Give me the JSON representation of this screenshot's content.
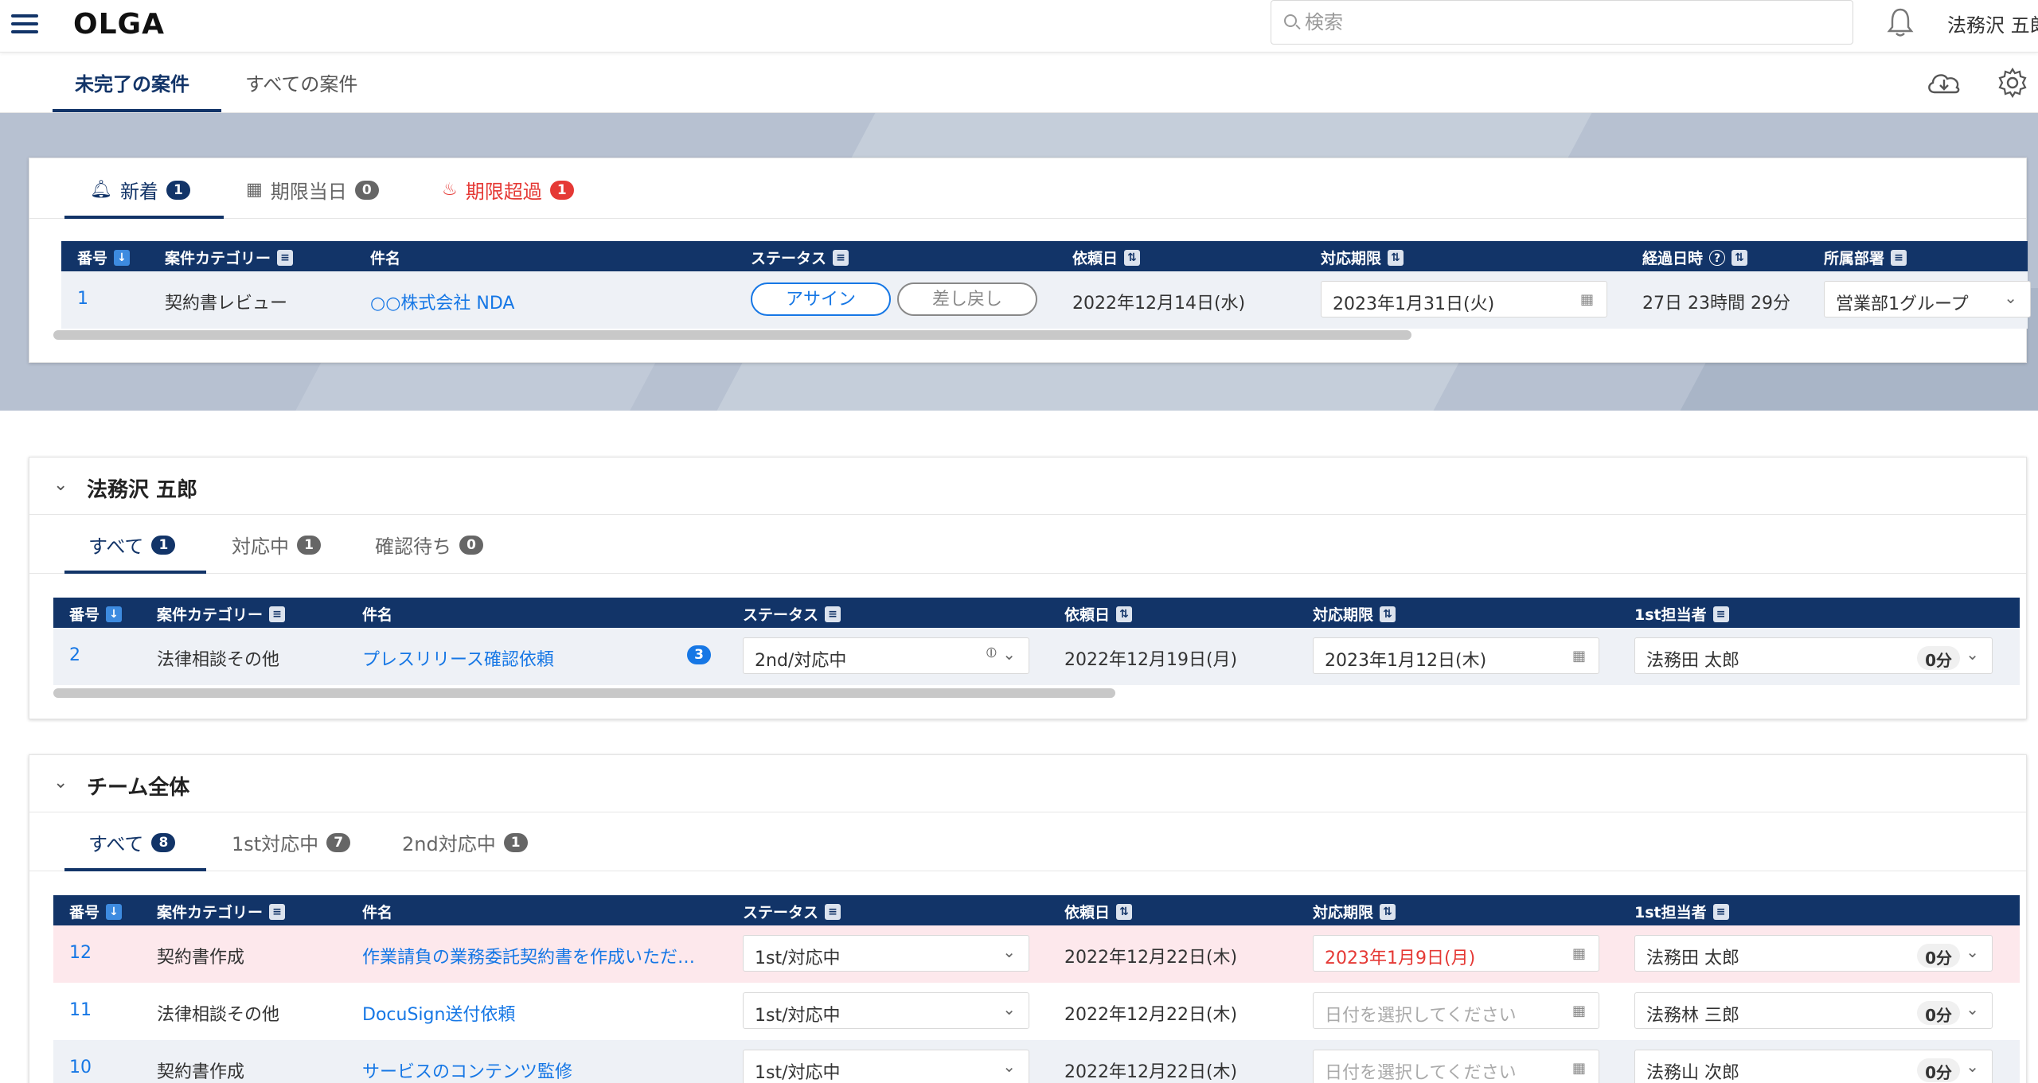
{
  "app": {
    "title": "OLGA"
  },
  "search": {
    "placeholder": "検索"
  },
  "user": {
    "name": "法務沢 五郎"
  },
  "main_tabs": [
    {
      "label": "未完了の案件",
      "active": true
    },
    {
      "label": "すべての案件",
      "active": false
    }
  ],
  "alerts": {
    "tabs": [
      {
        "label": "新着",
        "count": "1",
        "icon": "bell-icon"
      },
      {
        "label": "期限当日",
        "count": "0",
        "icon": "calendar-icon"
      },
      {
        "label": "期限超過",
        "count": "1",
        "icon": "fire-icon"
      }
    ],
    "headers": {
      "no": "番号",
      "category": "案件カテゴリー",
      "subject": "件名",
      "status": "ステータス",
      "requested": "依頼日",
      "deadline": "対応期限",
      "elapsed": "経過日時",
      "department": "所属部署"
    },
    "rows": [
      {
        "no": "1",
        "category": "契約書レビュー",
        "subject": "○○株式会社 NDA",
        "assign": "アサイン",
        "sendback": "差し戻し",
        "requested": "2022年12月14日(水)",
        "deadline": "2023年1月31日(火)",
        "elapsed": "27日 23時間 29分",
        "department": "営業部1グループ"
      }
    ]
  },
  "my_section": {
    "title": "法務沢 五郎",
    "tabs": [
      {
        "label": "すべて",
        "count": "1"
      },
      {
        "label": "対応中",
        "count": "1"
      },
      {
        "label": "確認待ち",
        "count": "0"
      }
    ],
    "headers": {
      "no": "番号",
      "category": "案件カテゴリー",
      "subject": "件名",
      "status": "ステータス",
      "requested": "依頼日",
      "deadline": "対応期限",
      "assignee": "1st担当者"
    },
    "rows": [
      {
        "no": "2",
        "category": "法律相談その他",
        "subject": "プレスリリース確認依頼",
        "comments": "3",
        "status": "2nd/対応中",
        "requested": "2022年12月19日(月)",
        "deadline": "2023年1月12日(木)",
        "assignee": "法務田 太郎",
        "time": "0分"
      }
    ]
  },
  "team_section": {
    "title": "チーム全体",
    "tabs": [
      {
        "label": "すべて",
        "count": "8"
      },
      {
        "label": "1st対応中",
        "count": "7"
      },
      {
        "label": "2nd対応中",
        "count": "1"
      }
    ],
    "headers": {
      "no": "番号",
      "category": "案件カテゴリー",
      "subject": "件名",
      "status": "ステータス",
      "requested": "依頼日",
      "deadline": "対応期限",
      "assignee": "1st担当者"
    },
    "date_placeholder": "日付を選択してください",
    "rows": [
      {
        "no": "12",
        "category": "契約書作成",
        "subject": "作業請負の業務委託契約書を作成いただ…",
        "status": "1st/対応中",
        "requested": "2022年12月22日(木)",
        "deadline": "2023年1月9日(月)",
        "assignee": "法務田 太郎",
        "time": "0分"
      },
      {
        "no": "11",
        "category": "法律相談その他",
        "subject": "DocuSign送付依頼",
        "status": "1st/対応中",
        "requested": "2022年12月22日(木)",
        "deadline": "",
        "assignee": "法務林 三郎",
        "time": "0分"
      },
      {
        "no": "10",
        "category": "契約書作成",
        "subject": "サービスのコンテンツ監修",
        "status": "1st/対応中",
        "requested": "2022年12月22日(木)",
        "deadline": "",
        "assignee": "法務山 次郎",
        "time": "0分"
      }
    ]
  },
  "colors": {
    "navy": "#123468",
    "link": "#1677e5",
    "danger": "#e53935",
    "hero": "#b7c1d1"
  }
}
